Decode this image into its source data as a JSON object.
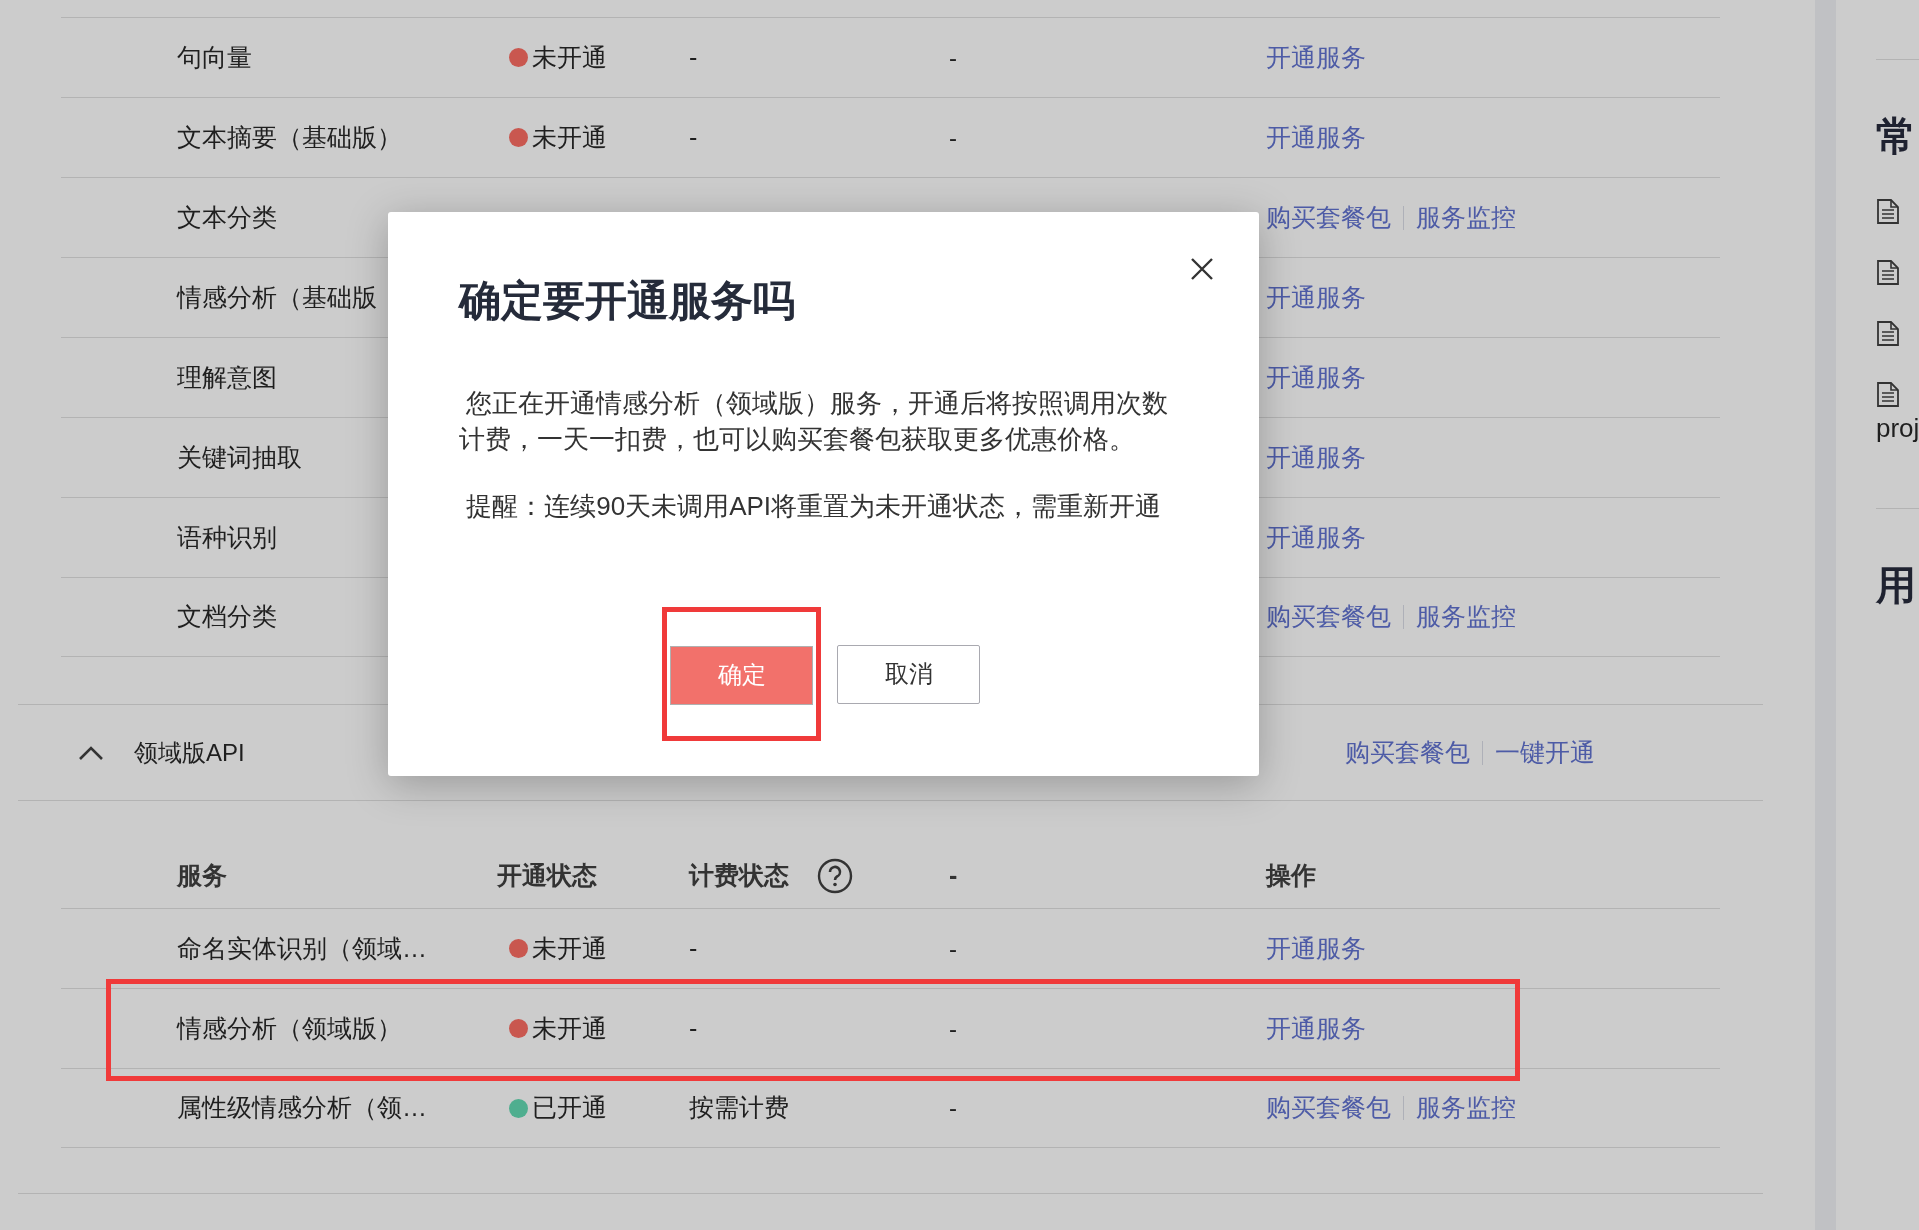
{
  "basic_rows": [
    {
      "name": "句向量",
      "status": {
        "label": "未开通",
        "active": false
      },
      "billing": "-",
      "column_4": "-",
      "actions": [
        "开通服务"
      ]
    },
    {
      "name": "文本摘要（基础版）",
      "status": {
        "label": "未开通",
        "active": false
      },
      "billing": "-",
      "column_4": "-",
      "actions": [
        "开通服务"
      ]
    },
    {
      "name": "文本分类",
      "actions": [
        "购买套餐包",
        "服务监控"
      ]
    },
    {
      "name": "情感分析（基础版",
      "actions": [
        "开通服务"
      ]
    },
    {
      "name": "理解意图",
      "actions": [
        "开通服务"
      ]
    },
    {
      "name": "关键词抽取",
      "actions": [
        "开通服务"
      ]
    },
    {
      "name": "语种识别",
      "actions": [
        "开通服务"
      ]
    },
    {
      "name": "文档分类",
      "actions": [
        "购买套餐包",
        "服务监控"
      ]
    }
  ],
  "domain_section": {
    "title": "领域版API",
    "expanded": true,
    "actions": [
      "购买套餐包",
      "一键开通"
    ],
    "columns": [
      "服务",
      "开通状态",
      "计费状态",
      "-",
      "操作"
    ],
    "rows": [
      {
        "name": "命名实体识别（领域…",
        "status": {
          "label": "未开通",
          "active": false
        },
        "billing": "-",
        "column_4": "-",
        "actions": [
          "开通服务"
        ],
        "highlighted": false
      },
      {
        "name": "情感分析（领域版）",
        "status": {
          "label": "未开通",
          "active": false
        },
        "billing": "-",
        "column_4": "-",
        "actions": [
          "开通服务"
        ],
        "highlighted": true
      },
      {
        "name": "属性级情感分析（领…",
        "status": {
          "label": "已开通",
          "active": true
        },
        "billing": "按需计费",
        "column_4": "-",
        "actions": [
          "购买套餐包",
          "服务监控"
        ],
        "highlighted": false
      }
    ]
  },
  "sidebar": {
    "sections": [
      {
        "heading": "常",
        "items": [
          {
            "kind": "document"
          },
          {
            "kind": "document"
          },
          {
            "kind": "document"
          },
          {
            "kind": "document",
            "text": "proj"
          }
        ]
      },
      {
        "heading": "用"
      }
    ]
  },
  "dialog": {
    "title": "确定要开通服务吗",
    "paragraphs": [
      " 您正在开通情感分析（领域版）服务，开通后将按照调用次数计费，一天一扣费，也可以购买套餐包获取更多优惠价格。",
      " 提醒：连续90天未调用API将重置为未开通状态，需重新开通"
    ],
    "confirm": {
      "label": "确定",
      "highlighted": true
    },
    "cancel": "取消"
  }
}
